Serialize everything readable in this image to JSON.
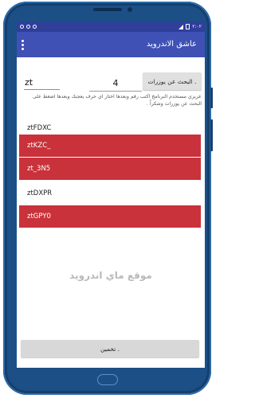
{
  "status_bar": {
    "time": "٢:٠٢"
  },
  "app_bar": {
    "title": "عاشق الاندرويد",
    "menu_icon": "overflow-menu-icon"
  },
  "form": {
    "name_value": "zt",
    "number_value": "4",
    "search_button_label": "البحث عن يوزرات .",
    "help_text": "عزيزي مستخدم البرنامج اكتب رقم وبعدها اختار اي حرف يعجبك وبعدها اضغط على البحث عن يوزرات وشكراً ."
  },
  "results": [
    {
      "text": "ztFDXC",
      "highlighted": false
    },
    {
      "text": "ztKZC_",
      "highlighted": true
    },
    {
      "text": "zt_3N5",
      "highlighted": true
    },
    {
      "text": "ztDXPR",
      "highlighted": false
    },
    {
      "text": "ztGPY0",
      "highlighted": true
    }
  ],
  "watermark": "موقع ماي اندرويد",
  "guess_button_label": "تخمين .",
  "colors": {
    "app_bar": "#3f51b5",
    "status_bar": "#2f3f9a",
    "highlight_row": "#c9323a",
    "phone_body": "#1c4f86"
  }
}
